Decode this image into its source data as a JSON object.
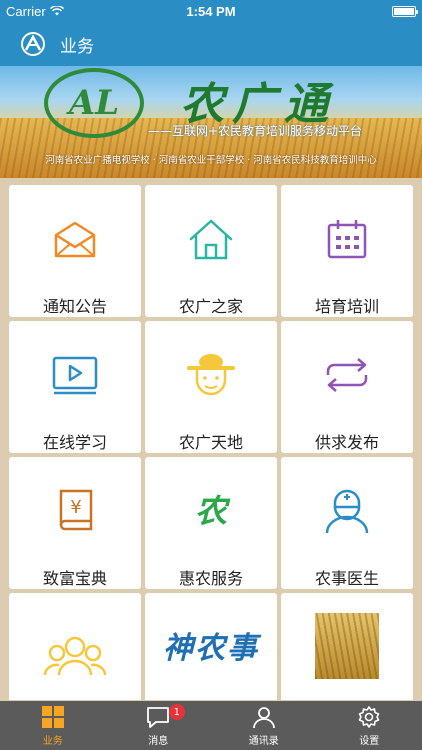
{
  "status_bar": {
    "carrier": "Carrier",
    "time": "1:54 PM"
  },
  "nav": {
    "title": "业务"
  },
  "banner": {
    "brand": "农广通",
    "slogan": "——互联网+农民教育培训服务移动平台",
    "schools": "河南省农业广播电视学校 · 河南省农业干部学校 · 河南省农民科技教育培训中心"
  },
  "tiles": [
    {
      "label": "通知公告",
      "icon": "envelope-icon"
    },
    {
      "label": "农广之家",
      "icon": "house-icon"
    },
    {
      "label": "培育培训",
      "icon": "calendar-icon"
    },
    {
      "label": "在线学习",
      "icon": "video-play-icon"
    },
    {
      "label": "农广天地",
      "icon": "farmer-face-icon"
    },
    {
      "label": "供求发布",
      "icon": "exchange-arrows-icon"
    },
    {
      "label": "致富宝典",
      "icon": "yuan-book-icon"
    },
    {
      "label": "惠农服务",
      "icon": "nong-character-icon"
    },
    {
      "label": "农事医生",
      "icon": "doctor-icon"
    }
  ],
  "partial_tiles": {
    "group": {
      "icon": "group-users-icon"
    },
    "calligraphy": {
      "text": "神农事"
    },
    "photo": {
      "icon": "wheat-photo"
    }
  },
  "tab_bar": {
    "items": [
      {
        "label": "业务",
        "icon": "grid-icon",
        "active": true
      },
      {
        "label": "消息",
        "icon": "chat-icon",
        "badge": "1"
      },
      {
        "label": "通讯录",
        "icon": "contact-icon"
      },
      {
        "label": "设置",
        "icon": "gear-icon"
      }
    ]
  },
  "colors": {
    "nav": "#2a8ec4",
    "tab_bar": "#5b5b5b",
    "active_tab": "#f5a623",
    "badge": "#e8323b"
  }
}
